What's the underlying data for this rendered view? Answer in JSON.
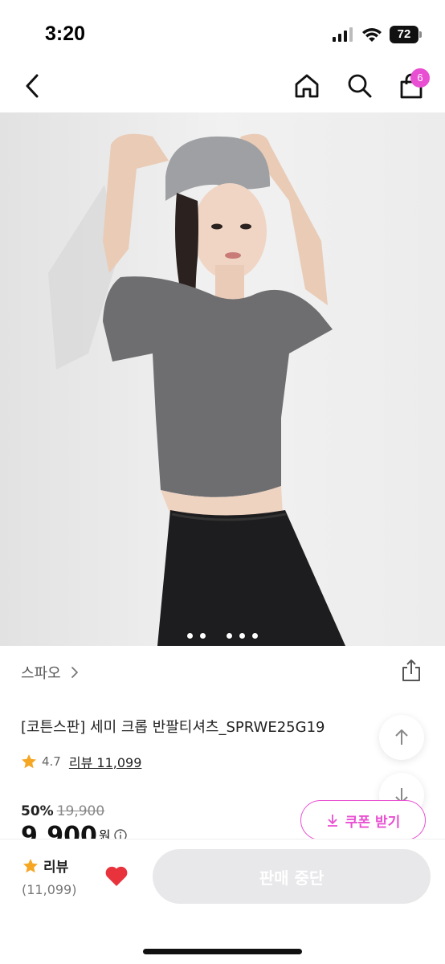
{
  "status_bar": {
    "time": "3:20",
    "battery": "72"
  },
  "nav": {
    "cart_badge": "6",
    "icons": [
      "back-icon",
      "home-icon",
      "search-icon",
      "shopping-bag-icon"
    ]
  },
  "gallery": {
    "image": "product-photo",
    "pages_total": 5,
    "dots_group1": 2,
    "dots_group2": 3
  },
  "product": {
    "brand": "스파오",
    "title": "[코튼스판] 세미 크롭 반팔티셔츠_SPRWE25G19",
    "rating": "4.7",
    "review_link": "리뷰 11,099",
    "discount": "50%",
    "original_price": "19,900",
    "sale_price": "9,900",
    "currency": "원"
  },
  "coupon": {
    "label": "쿠폰 받기"
  },
  "bottom_bar": {
    "review_label": "리뷰",
    "review_count": "(11,099)",
    "cta_label": "판매 중단"
  },
  "colors": {
    "accent": "#e94fd2",
    "heart": "#e8323c",
    "star": "#f5a623",
    "cta_disabled": "#e8e8ea"
  }
}
